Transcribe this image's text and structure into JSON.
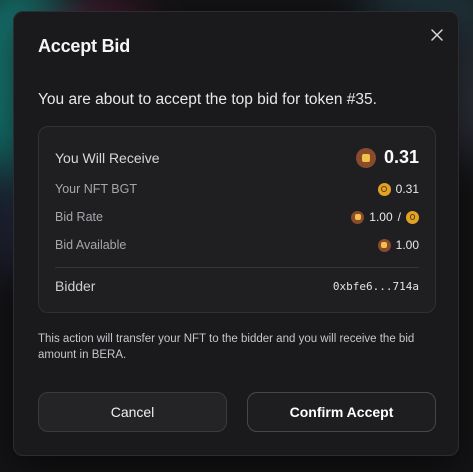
{
  "modal": {
    "title": "Accept Bid",
    "subtitle": "You are about to accept the top bid for token #35.",
    "close_icon": "close-icon"
  },
  "summary": {
    "receive_label": "You Will Receive",
    "receive_value": "0.31",
    "receive_token_icon": "bera-token-icon",
    "nft_bgt_label": "Your NFT BGT",
    "nft_bgt_value": "0.31",
    "nft_bgt_token_icon": "bgt-token-icon",
    "bid_rate_label": "Bid Rate",
    "bid_rate_value": "1.00",
    "bid_rate_separator": "/",
    "bid_available_label": "Bid Available",
    "bid_available_value": "1.00",
    "bidder_label": "Bidder",
    "bidder_value": "0xbfe6...714a"
  },
  "note": "This action will transfer your NFT to the bidder and you will receive the bid amount in BERA.",
  "buttons": {
    "cancel": "Cancel",
    "confirm": "Confirm Accept"
  },
  "colors": {
    "modal_bg": "#1a1a1c",
    "card_bg": "#1f1f22",
    "bera_token": "#8a4a2c",
    "bgt_token": "#e0a323"
  }
}
